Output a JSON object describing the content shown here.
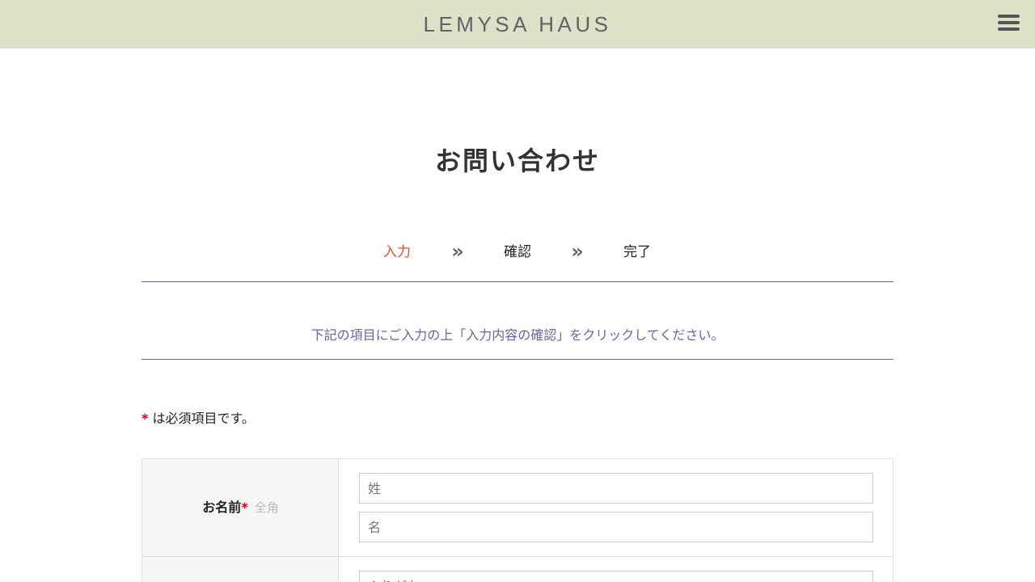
{
  "header": {
    "logo_text": "LEMYSA HAUS",
    "menu_icon": "hamburger-menu-icon"
  },
  "page": {
    "title": "お問い合わせ"
  },
  "steps": [
    {
      "label": "入力",
      "active": true
    },
    {
      "label": "確認",
      "active": false
    },
    {
      "label": "完了",
      "active": false
    }
  ],
  "step_separator": "»",
  "instruction": "下記の項目にご入力の上「入力内容の確認」をクリックしてください。",
  "required_note": {
    "mark": "*",
    "text": " は必須項目です。"
  },
  "form": {
    "rows": [
      {
        "label": "お名前",
        "required_mark": "*",
        "hint": "全角",
        "fields": [
          {
            "placeholder": "姓",
            "value": ""
          },
          {
            "placeholder": "名",
            "value": ""
          }
        ]
      }
    ],
    "next_row_placeholder": "ふりがな"
  },
  "colors": {
    "header_bg": "#dee0c8",
    "active_step": "#e9502c",
    "instruction_text": "#6a63a6",
    "rule": "#6b6690",
    "required": "#e60012"
  }
}
